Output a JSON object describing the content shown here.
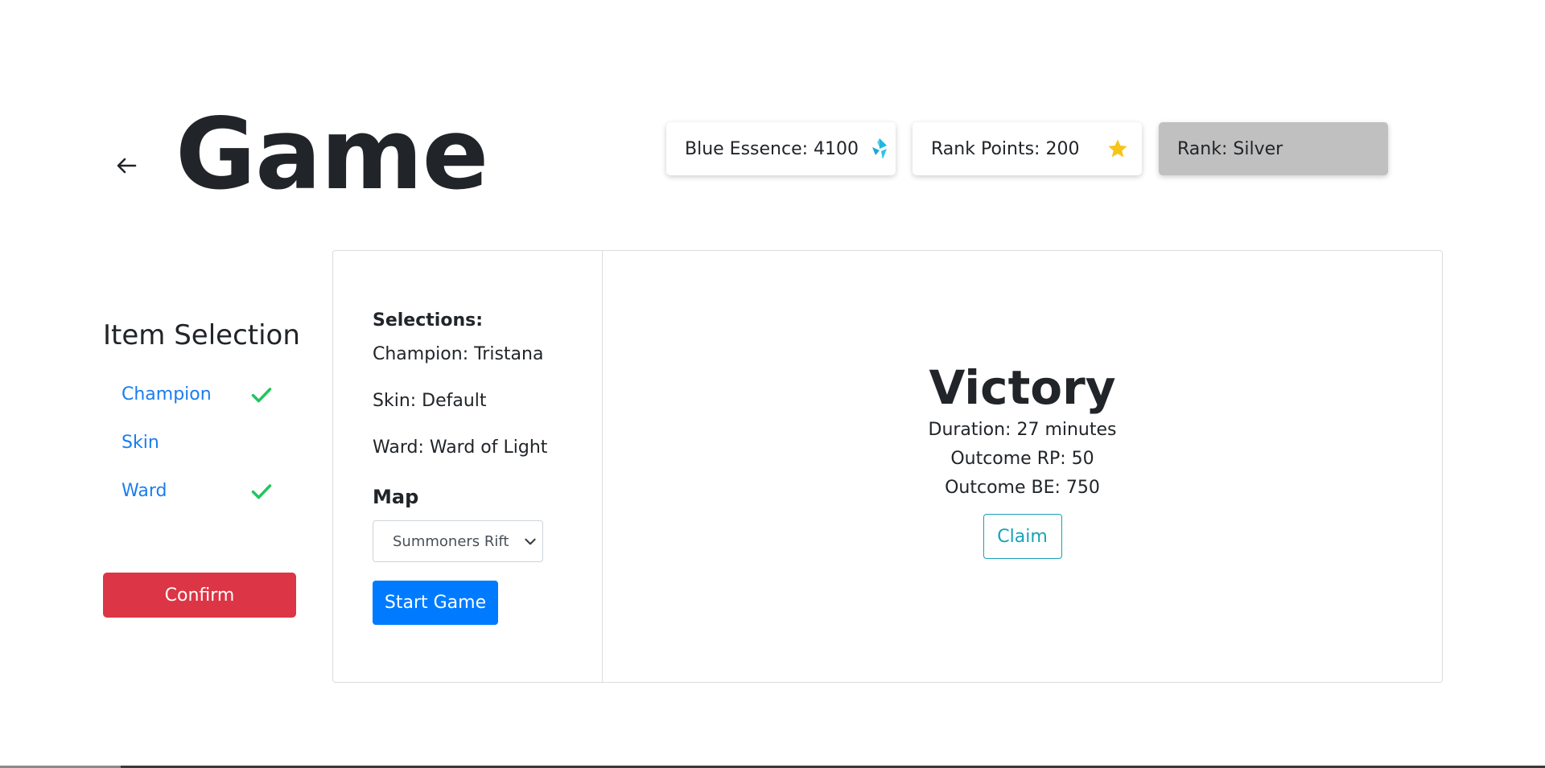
{
  "page": {
    "title": "Game"
  },
  "stats": {
    "blue_essence": "Blue Essence: 4100",
    "rank_points": "Rank Points: 200",
    "rank": "Rank: Silver"
  },
  "sidebar": {
    "title": "Item Selection",
    "items": [
      {
        "label": "Champion",
        "checked": true
      },
      {
        "label": "Skin",
        "checked": false
      },
      {
        "label": "Ward",
        "checked": true
      }
    ],
    "confirm_label": "Confirm"
  },
  "selections": {
    "heading": "Selections:",
    "champion": "Champion: Tristana",
    "skin": "Skin: Default",
    "ward": "Ward: Ward of Light",
    "map_label": "Map",
    "map_value": "Summoners Rift",
    "start_label": "Start Game"
  },
  "result": {
    "title": "Victory",
    "duration": "Duration: 27 minutes",
    "outcome_rp": "Outcome RP: 50",
    "outcome_be": "Outcome BE: 750",
    "claim_label": "Claim"
  },
  "colors": {
    "primary": "#007bff",
    "danger": "#dc3545",
    "info": "#17a2b8",
    "link": "#1a7df0",
    "check": "#22c55e",
    "rank_bg": "#c0c0c0",
    "star": "#f5c518",
    "essence": "#1fb6e0"
  },
  "icons": {
    "back": "arrow-left-icon",
    "essence": "blue-essence-icon",
    "rank_points": "star-icon",
    "check": "check-icon",
    "select": "chevron-down-icon"
  }
}
